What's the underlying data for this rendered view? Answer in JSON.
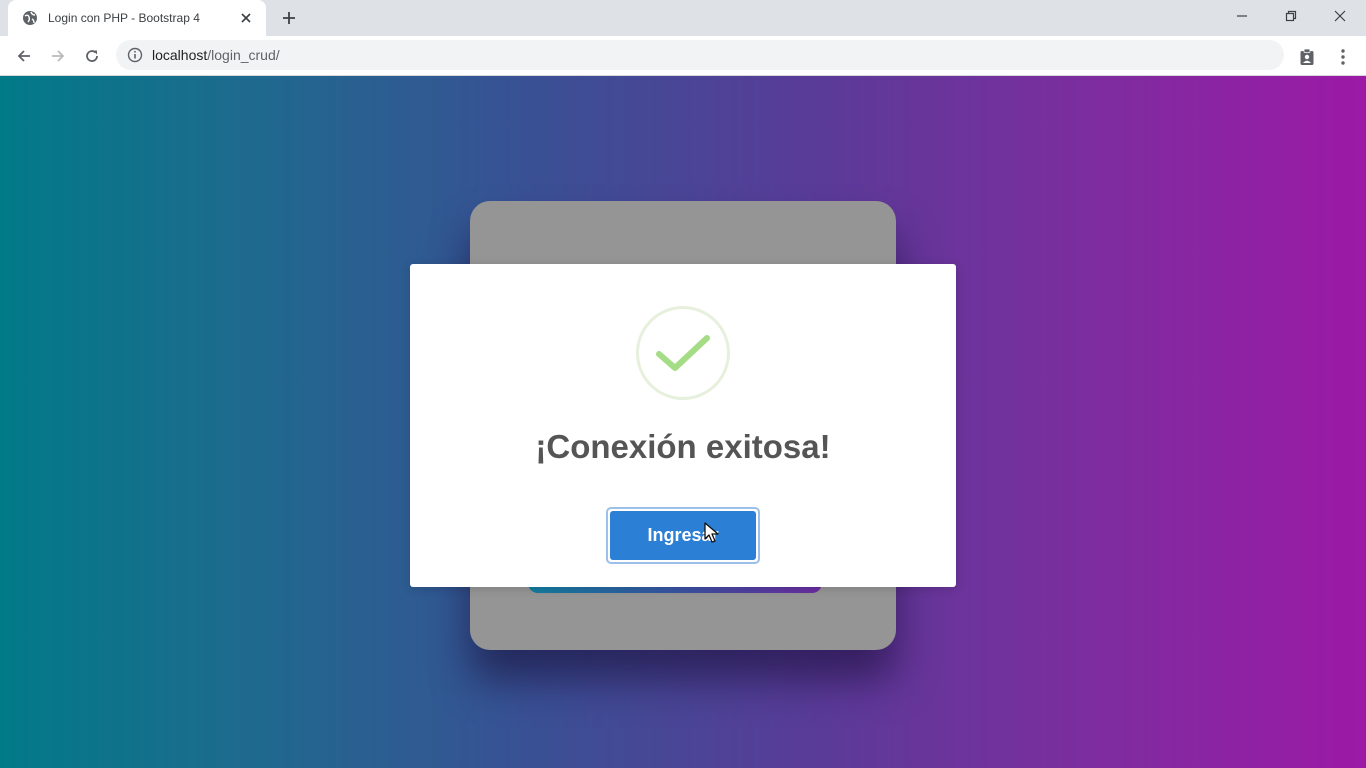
{
  "browser": {
    "tab_title": "Login con PHP - Bootstrap 4",
    "url_host": "localhost",
    "url_path": "/login_crud/"
  },
  "modal": {
    "title": "¡Conexión exitosa!",
    "confirm_label": "Ingresar",
    "icon": "checkmark-success-icon"
  },
  "colors": {
    "gradient_start": "#017a88",
    "gradient_end": "#9c19a6",
    "button": "#2b7fd4",
    "check": "#a5dc86"
  }
}
